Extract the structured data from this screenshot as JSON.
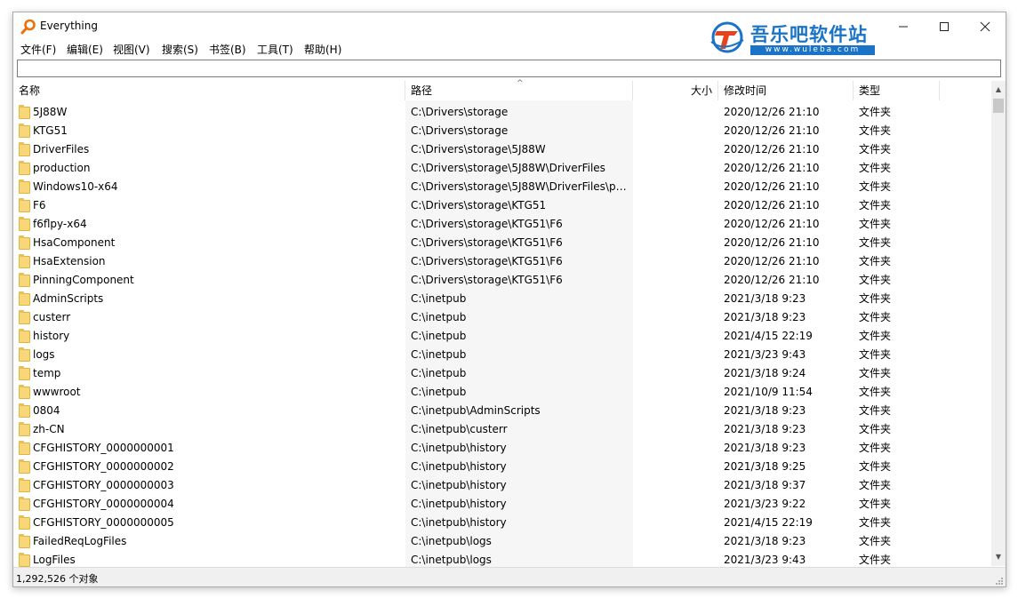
{
  "window": {
    "title": "Everything"
  },
  "watermark": {
    "title": "吾乐吧软件站",
    "url": "www.wuleba.com"
  },
  "menu": [
    "文件(F)",
    "编辑(E)",
    "视图(V)",
    "搜索(S)",
    "书签(B)",
    "工具(T)",
    "帮助(H)"
  ],
  "search": {
    "value": "",
    "placeholder": ""
  },
  "columns": {
    "name": "名称",
    "path": "路径",
    "size": "大小",
    "date": "修改时间",
    "type": "类型"
  },
  "rows": [
    {
      "name": "5J88W",
      "path": "C:\\Drivers\\storage",
      "date": "2020/12/26 21:10",
      "type": "文件夹"
    },
    {
      "name": "KTG51",
      "path": "C:\\Drivers\\storage",
      "date": "2020/12/26 21:10",
      "type": "文件夹"
    },
    {
      "name": "DriverFiles",
      "path": "C:\\Drivers\\storage\\5J88W",
      "date": "2020/12/26 21:10",
      "type": "文件夹"
    },
    {
      "name": "production",
      "path": "C:\\Drivers\\storage\\5J88W\\DriverFiles",
      "date": "2020/12/26 21:10",
      "type": "文件夹"
    },
    {
      "name": "Windows10-x64",
      "path": "C:\\Drivers\\storage\\5J88W\\DriverFiles\\pr...",
      "date": "2020/12/26 21:10",
      "type": "文件夹"
    },
    {
      "name": "F6",
      "path": "C:\\Drivers\\storage\\KTG51",
      "date": "2020/12/26 21:10",
      "type": "文件夹"
    },
    {
      "name": "f6flpy-x64",
      "path": "C:\\Drivers\\storage\\KTG51\\F6",
      "date": "2020/12/26 21:10",
      "type": "文件夹"
    },
    {
      "name": "HsaComponent",
      "path": "C:\\Drivers\\storage\\KTG51\\F6",
      "date": "2020/12/26 21:10",
      "type": "文件夹"
    },
    {
      "name": "HsaExtension",
      "path": "C:\\Drivers\\storage\\KTG51\\F6",
      "date": "2020/12/26 21:10",
      "type": "文件夹"
    },
    {
      "name": "PinningComponent",
      "path": "C:\\Drivers\\storage\\KTG51\\F6",
      "date": "2020/12/26 21:10",
      "type": "文件夹"
    },
    {
      "name": "AdminScripts",
      "path": "C:\\inetpub",
      "date": "2021/3/18 9:23",
      "type": "文件夹"
    },
    {
      "name": "custerr",
      "path": "C:\\inetpub",
      "date": "2021/3/18 9:23",
      "type": "文件夹"
    },
    {
      "name": "history",
      "path": "C:\\inetpub",
      "date": "2021/4/15 22:19",
      "type": "文件夹"
    },
    {
      "name": "logs",
      "path": "C:\\inetpub",
      "date": "2021/3/23 9:43",
      "type": "文件夹"
    },
    {
      "name": "temp",
      "path": "C:\\inetpub",
      "date": "2021/3/18 9:24",
      "type": "文件夹"
    },
    {
      "name": "wwwroot",
      "path": "C:\\inetpub",
      "date": "2021/10/9 11:54",
      "type": "文件夹"
    },
    {
      "name": "0804",
      "path": "C:\\inetpub\\AdminScripts",
      "date": "2021/3/18 9:23",
      "type": "文件夹"
    },
    {
      "name": "zh-CN",
      "path": "C:\\inetpub\\custerr",
      "date": "2021/3/18 9:23",
      "type": "文件夹"
    },
    {
      "name": "CFGHISTORY_0000000001",
      "path": "C:\\inetpub\\history",
      "date": "2021/3/18 9:23",
      "type": "文件夹"
    },
    {
      "name": "CFGHISTORY_0000000002",
      "path": "C:\\inetpub\\history",
      "date": "2021/3/18 9:25",
      "type": "文件夹"
    },
    {
      "name": "CFGHISTORY_0000000003",
      "path": "C:\\inetpub\\history",
      "date": "2021/3/18 9:37",
      "type": "文件夹"
    },
    {
      "name": "CFGHISTORY_0000000004",
      "path": "C:\\inetpub\\history",
      "date": "2021/3/23 9:22",
      "type": "文件夹"
    },
    {
      "name": "CFGHISTORY_0000000005",
      "path": "C:\\inetpub\\history",
      "date": "2021/4/15 22:19",
      "type": "文件夹"
    },
    {
      "name": "FailedReqLogFiles",
      "path": "C:\\inetpub\\logs",
      "date": "2021/3/18 9:23",
      "type": "文件夹"
    },
    {
      "name": "LogFiles",
      "path": "C:\\inetpub\\logs",
      "date": "2021/3/23 9:43",
      "type": "文件夹"
    }
  ],
  "status": {
    "text": "1,292,526 个对象"
  },
  "icons": {
    "app": "magnifier-icon",
    "folder": "folder-icon",
    "watermark": "watermark-logo-icon"
  },
  "colors": {
    "folder": "#f8d77a",
    "watermark": "#1a73c7"
  }
}
